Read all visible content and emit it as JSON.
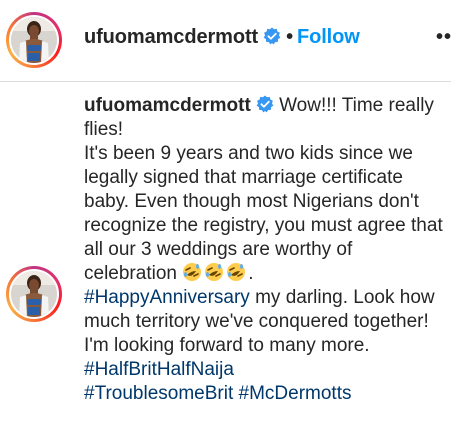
{
  "header": {
    "username": "ufuomamcdermott",
    "separator": "•",
    "follow_label": "Follow",
    "more_label": "••"
  },
  "caption": {
    "username": "ufuomamcdermott",
    "line1": " Wow!!! Time really flies!",
    "line2": "It's been 9 years and two kids since we legally signed that marriage certificate baby. Even though most Nigerians don't recognize the registry, you must agree that all our 3 weddings are worthy of celebration ",
    "after_emojis": ".",
    "hashtag1": "#HappyAnniversary",
    "line3": " my darling. Look how much territory we've conquered together! I'm looking forward to many more. ",
    "hashtag2": "#HalfBritHalfNaija",
    "hashtag3": "#TroublesomeBrit",
    "hashtag4": "#McDermotts",
    "emoji_names": [
      "rolling-on-floor-laughing-emoji",
      "rolling-on-floor-laughing-emoji",
      "rolling-on-floor-laughing-emoji"
    ]
  },
  "colors": {
    "link_blue": "#0095f6",
    "hashtag_blue": "#00376b",
    "verified_blue": "#3897f0",
    "text": "#262626"
  }
}
